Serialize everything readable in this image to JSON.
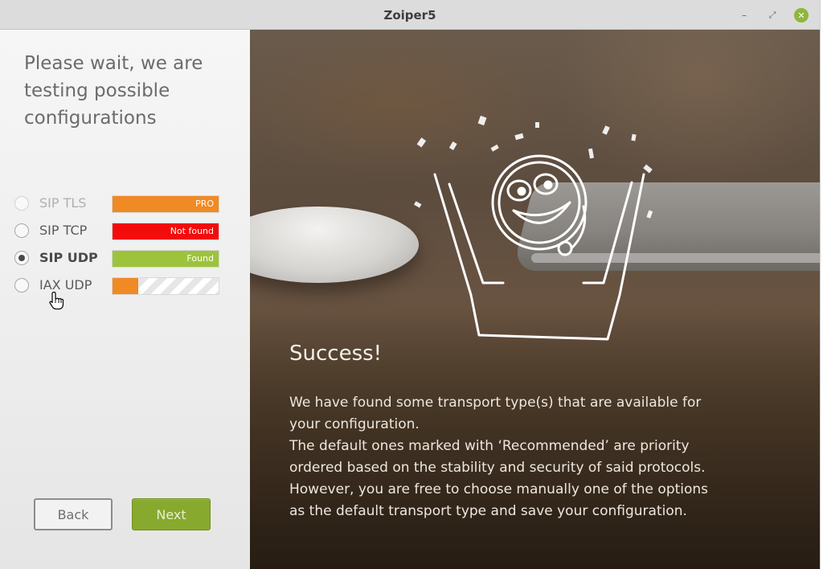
{
  "window": {
    "title": "Zoiper5",
    "controls": {
      "minimize": "–",
      "maximize": "⤢",
      "close": "✕"
    }
  },
  "left_panel": {
    "heading_lines": [
      "Please wait, we are",
      "testing possible",
      "configurations"
    ],
    "transports": [
      {
        "label": "SIP TLS",
        "state": "disabled",
        "status": "PRO",
        "status_color": "#f08a24",
        "progress": 1.0
      },
      {
        "label": "SIP TCP",
        "state": "normal",
        "status": "Not found",
        "status_color": "#f20c0c",
        "progress": 1.0
      },
      {
        "label": "SIP UDP",
        "state": "selected",
        "status": "Found",
        "status_color": "#9dc33c",
        "progress": 1.0
      },
      {
        "label": "IAX UDP",
        "state": "normal",
        "status": "",
        "status_color": "#f08a24",
        "progress": 0.24
      }
    ],
    "buttons": {
      "back": "Back",
      "next": "Next"
    }
  },
  "right_panel": {
    "title": "Success!",
    "message_lines": [
      "We have found some transport type(s) that are available for",
      "your configuration.",
      "The default ones marked with ‘Recommended’ are priority",
      "ordered based on the stability and security of said protocols.",
      "However, you are free to choose manually one of the options",
      "as the default  transport type and save your configuration."
    ]
  },
  "colors": {
    "accent_green": "#86a92e",
    "pro_orange": "#f08a24",
    "not_found_red": "#f20c0c",
    "found_green": "#9dc33c"
  }
}
